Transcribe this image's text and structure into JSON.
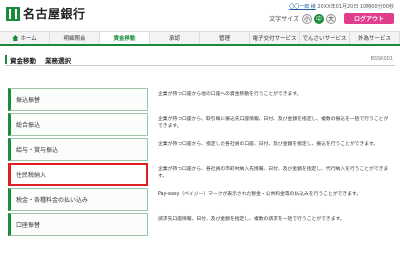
{
  "header": {
    "bank_name": "名古屋銀行",
    "user_prefix": "",
    "user_name": "〇〇一郎 様",
    "last_login": "20XX年01月20日 10時00分00秒",
    "font_size_label": "文字サイズ",
    "font_sizes": [
      "小",
      "中",
      "大"
    ],
    "logout_label": "ログアウト"
  },
  "nav": {
    "items": [
      "ホーム",
      "明細照会",
      "資金移動",
      "承認",
      "管理",
      "電子交付サービス",
      "でんさいサービス",
      "外為サービス"
    ],
    "active_index": 2
  },
  "page": {
    "title": "資金移動",
    "subtitle": "業務選択",
    "screen_code": "BSSK001"
  },
  "menu": [
    {
      "label": "振込振替",
      "desc": "企業が持つ口座から他の口座への資金移動を行うことができます。",
      "selected": false
    },
    {
      "label": "総合振込",
      "desc": "企業が持つ口座から、取引毎に振込先口座情報、日付、及び金額を指定し、複数の振込を一括で行うことができます。",
      "selected": false
    },
    {
      "label": "給与・賞与振込",
      "desc": "企業が持つ口座から、指定した各社員の口座、日付、及び金額を指定し、振込を行うことができます。",
      "selected": false
    },
    {
      "label": "住民税納入",
      "desc": "企業が持つ口座から、各社員の市町村納入先情報、日付、及び金額を指定し、代行納入を行うことができます。",
      "selected": true
    },
    {
      "label": "税金・各種料金の払い込み",
      "desc": "Pay-easy（ペイジー）マークが表示された税金・公共料金等の払込みを行うことができます。",
      "selected": false
    },
    {
      "label": "口座振替",
      "desc": "請求先口座情報、日付、及び金額を指定し、複数の請求を一括で行うことができます。",
      "selected": false
    }
  ],
  "colors": {
    "brand_green": "#1a8a3c",
    "logout_pink": "#e23c8c",
    "highlight_red": "#e02020"
  }
}
